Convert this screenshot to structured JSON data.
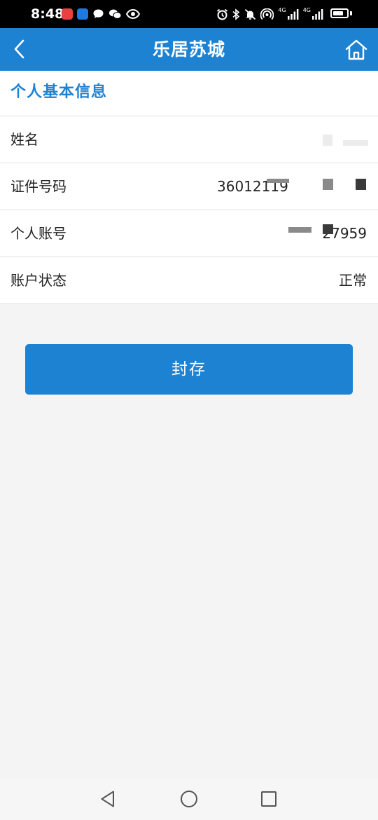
{
  "status_bar": {
    "time": "8:48",
    "network_label_1": "4G",
    "network_label_2": "4G",
    "battery_level": 0.8,
    "icons": [
      "red-app-icon",
      "blue-app-icon",
      "message-icon",
      "wechat-icon",
      "eye-icon",
      "alarm-icon",
      "bluetooth-icon",
      "mute-icon",
      "hotspot-icon",
      "signal-icon",
      "signal-icon",
      "battery-icon"
    ]
  },
  "nav": {
    "title": "乐居苏城",
    "back_icon": "chevron-left-icon",
    "home_icon": "home-icon"
  },
  "section": {
    "title": "个人基本信息"
  },
  "info": {
    "rows": [
      {
        "label": "姓名",
        "value": ""
      },
      {
        "label": "证件号码",
        "value": "36012119"
      },
      {
        "label": "个人账号",
        "value": "27959"
      },
      {
        "label": "账户状态",
        "value": "正常"
      }
    ]
  },
  "actions": {
    "seal_label": "封存"
  },
  "system_nav": {
    "icons": [
      "back-triangle-icon",
      "home-circle-icon",
      "recent-square-icon"
    ]
  },
  "colors": {
    "primary": "#1e82d2",
    "background": "#f4f4f4",
    "text": "#222222"
  }
}
